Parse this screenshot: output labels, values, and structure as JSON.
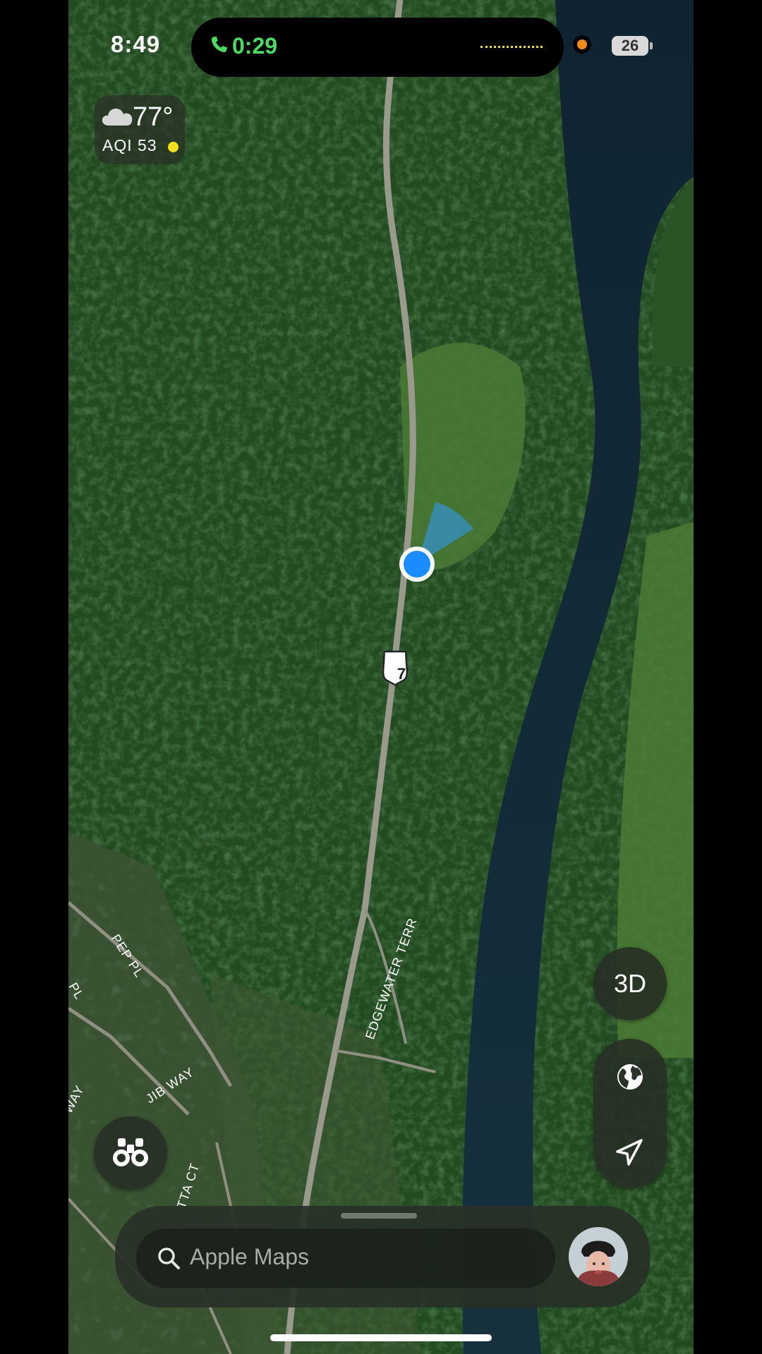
{
  "status_bar": {
    "time": "8:49",
    "call_duration": "0:29",
    "battery": "26",
    "call_color": "#4cd964",
    "recording_dot_color": "#f28b1a"
  },
  "weather": {
    "icon": "cloud-icon",
    "temperature": "77°",
    "aqi": "AQI 53",
    "aqi_color": "#f4df1c"
  },
  "map": {
    "type": "satellite",
    "road_shield": "7",
    "street_labels": [
      "EDGEWATER TERR",
      "PEP PL",
      "JIB WAY",
      "PL",
      "WAY",
      "TTA CT"
    ],
    "location_marker_color": "#1a8cff"
  },
  "controls": {
    "view_3d_label": "3D",
    "map_mode_icon": "globe-icon",
    "tracking_icon": "location-arrow-icon",
    "look_around_icon": "binoculars-icon"
  },
  "search": {
    "placeholder": "Apple Maps",
    "icon": "magnifier-icon"
  }
}
